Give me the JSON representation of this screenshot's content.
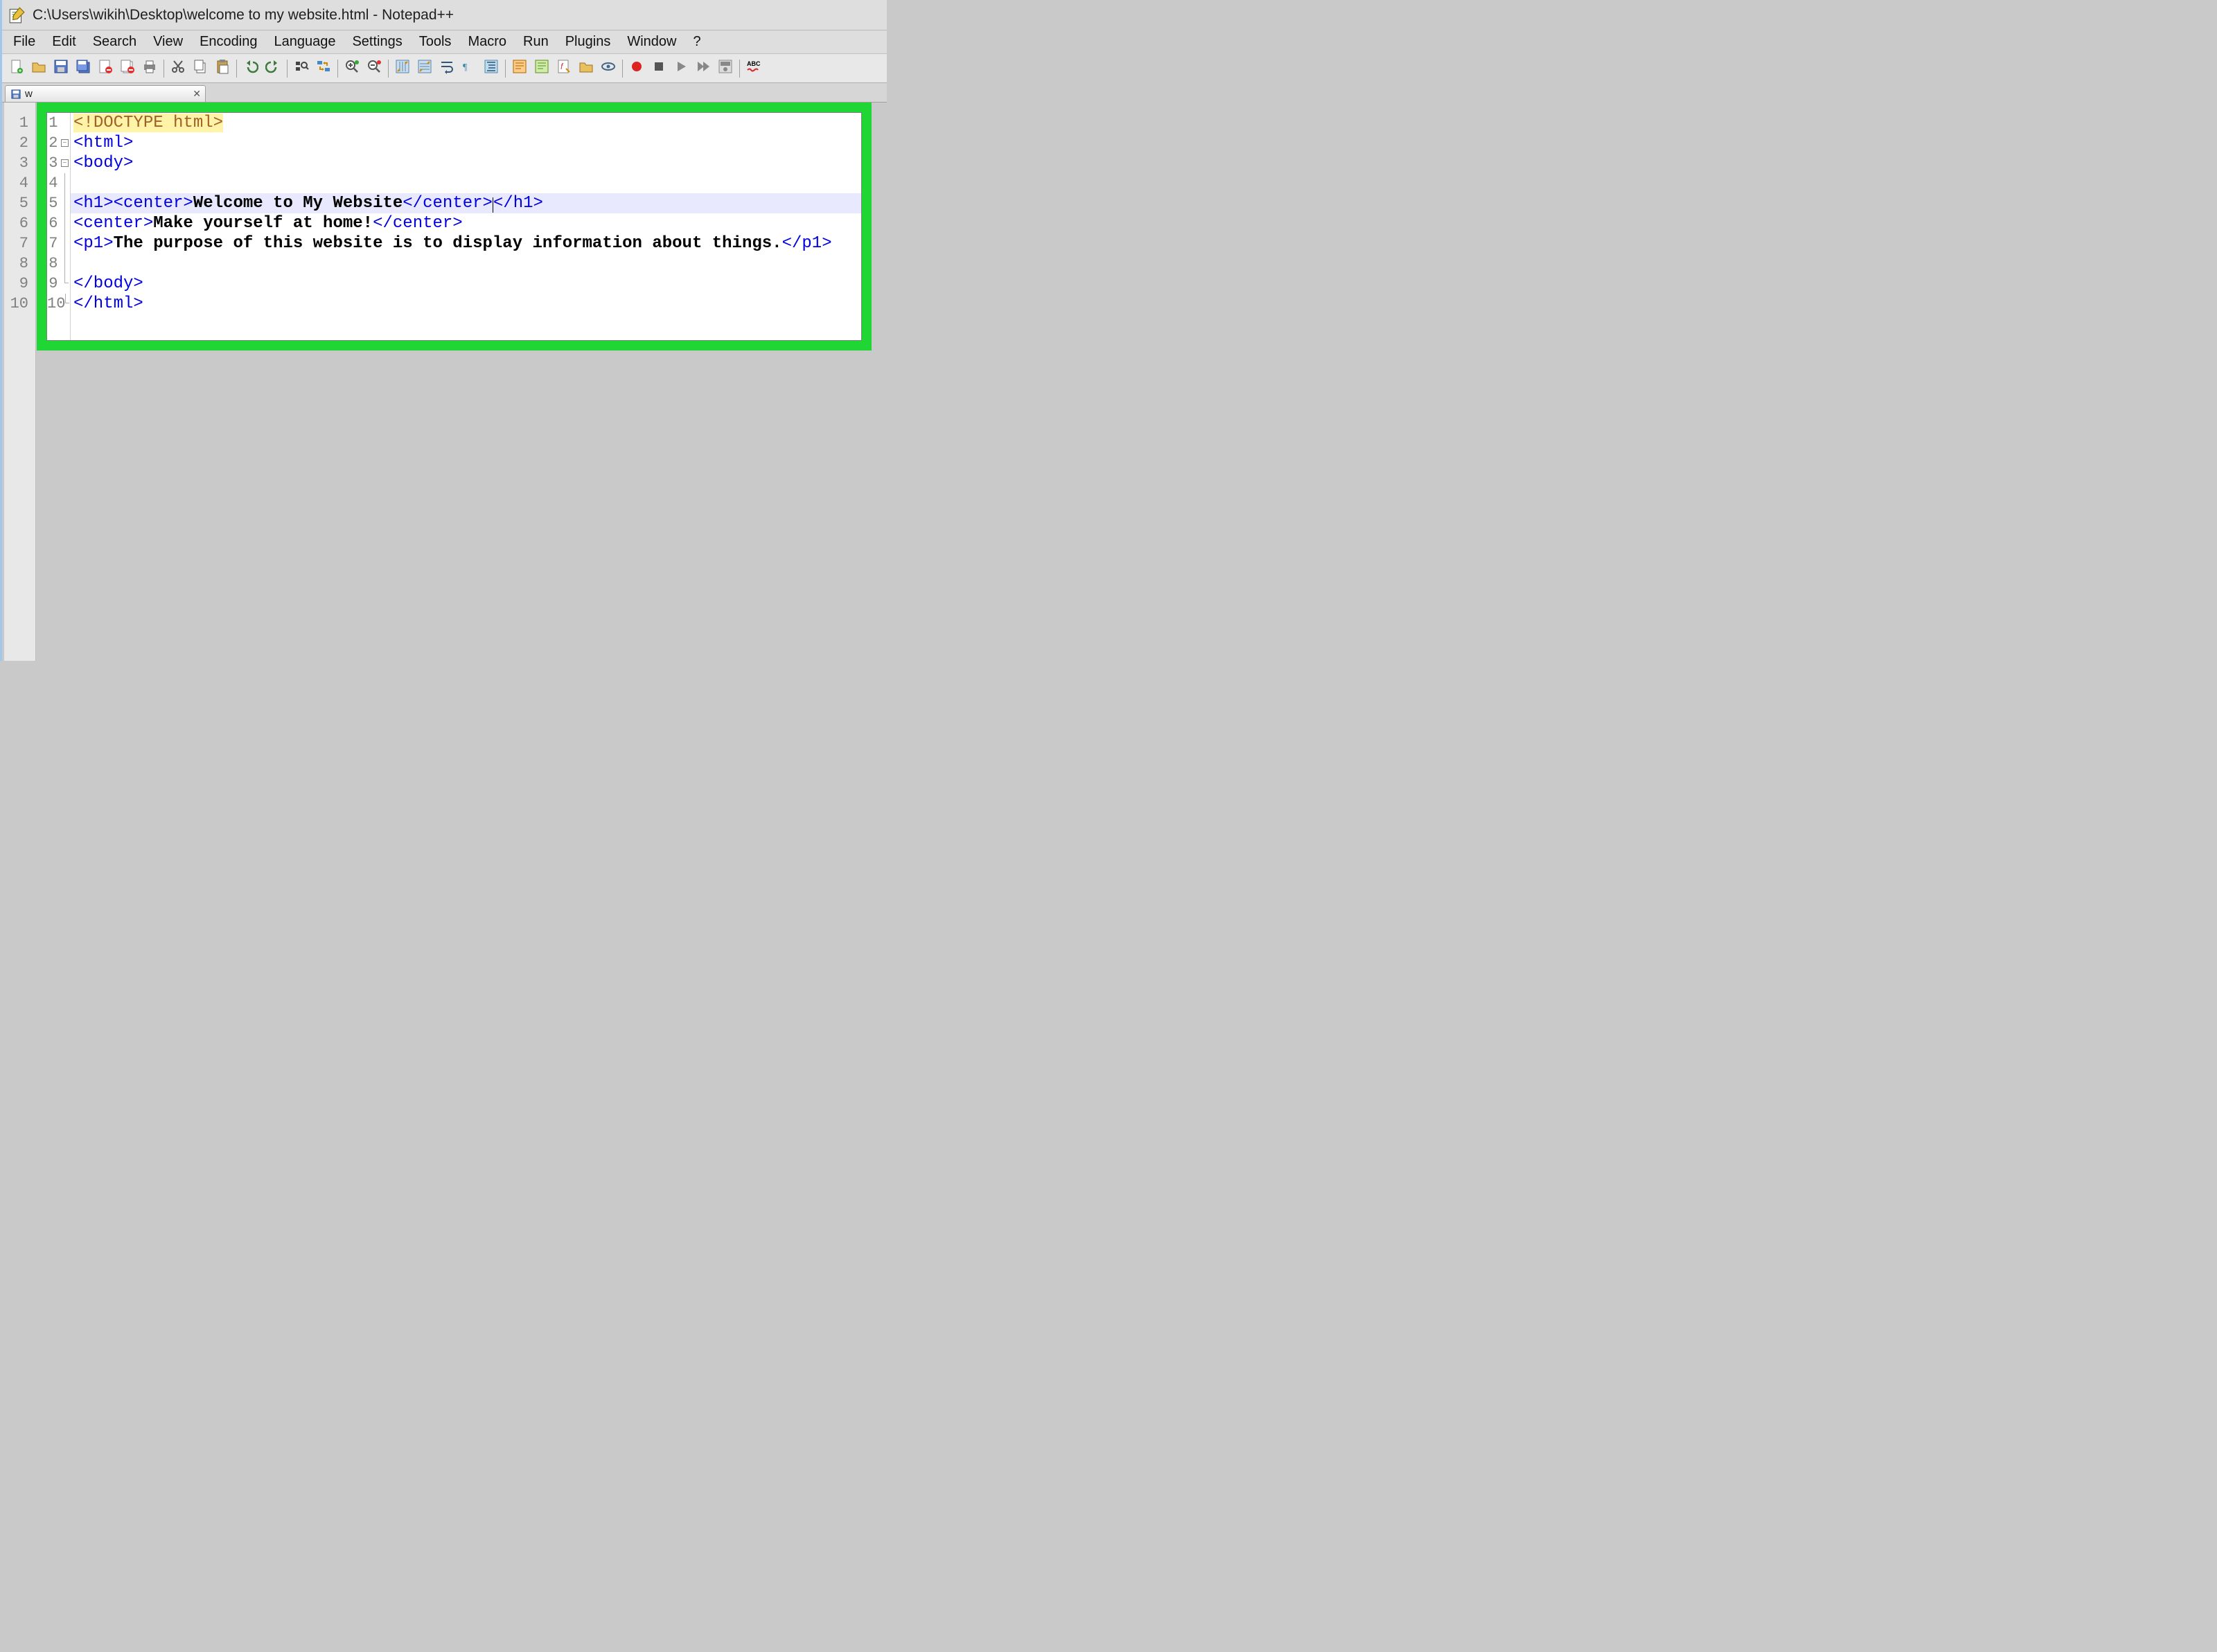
{
  "title": "C:\\Users\\wikih\\Desktop\\welcome to my website.html - Notepad++",
  "menu": [
    "File",
    "Edit",
    "Search",
    "View",
    "Encoding",
    "Language",
    "Settings",
    "Tools",
    "Macro",
    "Run",
    "Plugins",
    "Window",
    "?"
  ],
  "tab": {
    "label": "w",
    "full": "welcome to my website.html"
  },
  "toolbar_icons": [
    "new-file",
    "open-file",
    "save",
    "save-all",
    "close",
    "close-all",
    "print",
    "cut",
    "copy",
    "paste",
    "undo",
    "redo",
    "find",
    "find-replace",
    "zoom-in",
    "zoom-out",
    "sync-v",
    "sync-h",
    "word-wrap",
    "show-all-chars",
    "indent-guide",
    "ide-1",
    "ide-2",
    "function-list",
    "folder",
    "eye",
    "record-macro",
    "stop-macro",
    "play-macro",
    "play-multi",
    "macro-save",
    "spellcheck"
  ],
  "code": {
    "lines": [
      {
        "n": 1,
        "fold": "",
        "segments": [
          {
            "cls": "doctype sel",
            "t": "<!"
          },
          {
            "cls": "doctype",
            "t": "DOCTYPE html"
          },
          {
            "cls": "doctype sel",
            "t": ">"
          }
        ]
      },
      {
        "n": 2,
        "fold": "open",
        "segments": [
          {
            "cls": "tag",
            "t": "<html>"
          }
        ]
      },
      {
        "n": 3,
        "fold": "open",
        "segments": [
          {
            "cls": "tag",
            "t": "<body>"
          }
        ]
      },
      {
        "n": 4,
        "fold": "line",
        "segments": []
      },
      {
        "n": 5,
        "fold": "line",
        "hl": true,
        "segments": [
          {
            "cls": "tag",
            "t": "<h1><center>"
          },
          {
            "cls": "txt",
            "t": "Welcome to My Website"
          },
          {
            "cls": "tag",
            "t": "</center>"
          },
          {
            "cls": "",
            "t": "",
            "caret": true
          },
          {
            "cls": "tag",
            "t": "</h1>"
          }
        ]
      },
      {
        "n": 6,
        "fold": "line",
        "segments": [
          {
            "cls": "tag",
            "t": "<center>"
          },
          {
            "cls": "txt",
            "t": "Make yourself at home!"
          },
          {
            "cls": "tag",
            "t": "</center>"
          }
        ]
      },
      {
        "n": 7,
        "fold": "line",
        "segments": [
          {
            "cls": "tag",
            "t": "<p1>"
          },
          {
            "cls": "txt",
            "t": "The purpose of this website is to display information about things."
          },
          {
            "cls": "tag",
            "t": "</p1>"
          }
        ]
      },
      {
        "n": 8,
        "fold": "line",
        "segments": []
      },
      {
        "n": 9,
        "fold": "corner",
        "segments": [
          {
            "cls": "tag",
            "t": "</body>"
          }
        ]
      },
      {
        "n": 10,
        "fold": "corner",
        "segments": [
          {
            "cls": "tag",
            "t": "</html>"
          }
        ]
      }
    ]
  }
}
